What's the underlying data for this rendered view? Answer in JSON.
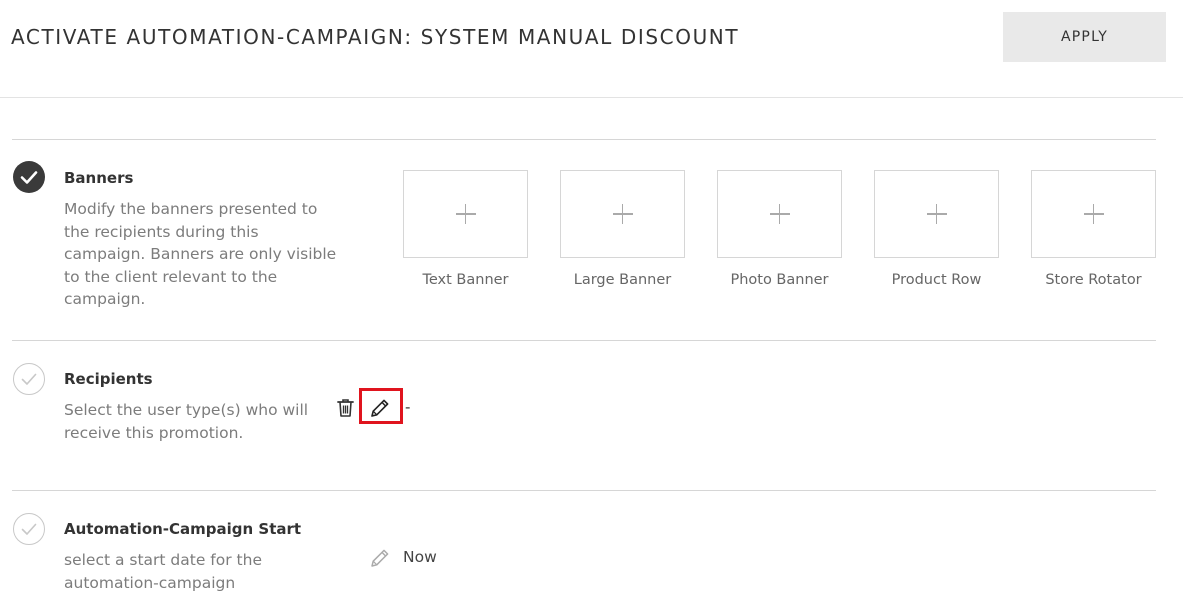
{
  "header": {
    "title": "ACTIVATE AUTOMATION-CAMPAIGN: SYSTEM MANUAL DISCOUNT",
    "apply_label": "APPLY"
  },
  "sections": {
    "banners": {
      "status": "complete",
      "title": "Banners",
      "desc_lines": [
        "Modify the banners presented to",
        "the recipients during this",
        "campaign. Banners are only visible",
        "to the client relevant to the",
        "campaign."
      ],
      "tiles": [
        {
          "label": "Text Banner",
          "icon": "plus-icon"
        },
        {
          "label": "Large Banner",
          "icon": "plus-icon"
        },
        {
          "label": "Photo Banner",
          "icon": "plus-icon"
        },
        {
          "label": "Product Row",
          "icon": "plus-icon"
        },
        {
          "label": "Store Rotator",
          "icon": "plus-icon"
        }
      ]
    },
    "recipients": {
      "status": "incomplete",
      "title": "Recipients",
      "desc_lines": [
        "Select the user type(s) who will",
        "receive this promotion."
      ],
      "value": "-",
      "actions": [
        "trash-icon",
        "pencil-icon"
      ]
    },
    "start": {
      "status": "incomplete",
      "title": "Automation-Campaign Start",
      "desc_lines": [
        "select a start date for the",
        "automation-campaign"
      ],
      "value": "Now",
      "actions": [
        "pencil-icon"
      ]
    }
  },
  "colors": {
    "highlight": "#e0141e",
    "complete_badge": "#3a3a3a",
    "apply_bg": "#e9e9e9"
  }
}
